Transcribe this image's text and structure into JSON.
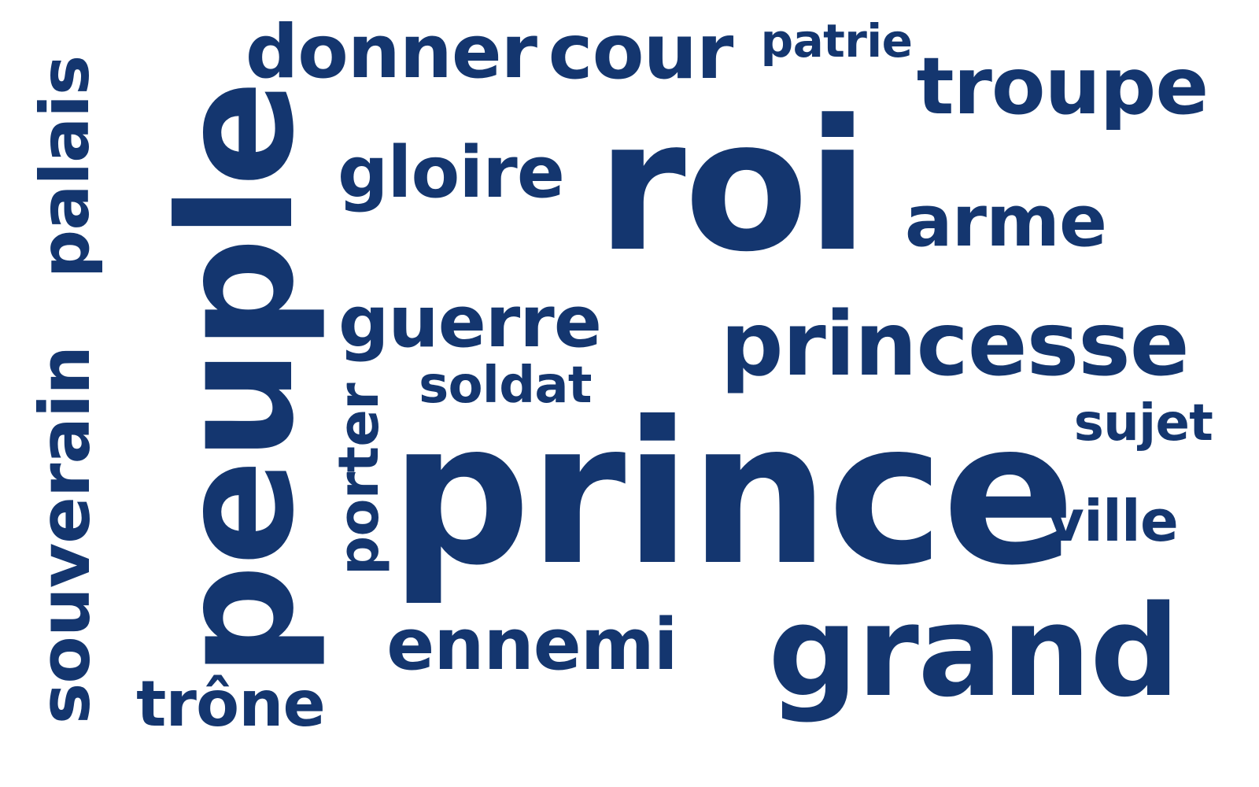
{
  "colors": {
    "background": "#ffffff",
    "word": "#14366f"
  },
  "words": [
    {
      "text": "prince",
      "weight": 1.0
    },
    {
      "text": "roi",
      "weight": 0.93
    },
    {
      "text": "peuple",
      "weight": 0.8
    },
    {
      "text": "grand",
      "weight": 0.64
    },
    {
      "text": "princesse",
      "weight": 0.46
    },
    {
      "text": "troupe",
      "weight": 0.4
    },
    {
      "text": "cour",
      "weight": 0.38
    },
    {
      "text": "donner",
      "weight": 0.36
    },
    {
      "text": "gloire",
      "weight": 0.34
    },
    {
      "text": "guerre",
      "weight": 0.34
    },
    {
      "text": "arme",
      "weight": 0.34
    },
    {
      "text": "ennemi",
      "weight": 0.34
    },
    {
      "text": "souverain",
      "weight": 0.34
    },
    {
      "text": "palais",
      "weight": 0.33
    },
    {
      "text": "trône",
      "weight": 0.3
    },
    {
      "text": "ville",
      "weight": 0.28
    },
    {
      "text": "porter",
      "weight": 0.27
    },
    {
      "text": "soldat",
      "weight": 0.22
    },
    {
      "text": "sujet",
      "weight": 0.22
    },
    {
      "text": "patrie",
      "weight": 0.2
    }
  ]
}
